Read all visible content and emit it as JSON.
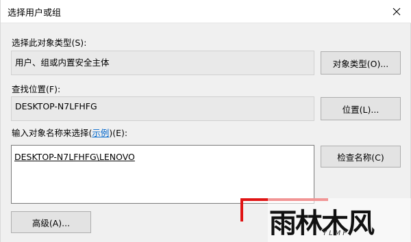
{
  "window": {
    "title": "选择用户或组",
    "close_symbol": "✕"
  },
  "object_type": {
    "label": "选择此对象类型(S):",
    "value": "用户、组或内置安全主体",
    "button": "对象类型(O)..."
  },
  "location": {
    "label": "查找位置(F):",
    "value": "DESKTOP-N7LFHFG",
    "button": "位置(L)..."
  },
  "names": {
    "label_prefix": "输入对象名称来选择(",
    "label_link": "示例",
    "label_suffix": ")(E):",
    "value": "DESKTOP-N7LFHFG\\LENOVO",
    "button": "检查名称(C)"
  },
  "advanced": {
    "button": "高级(A)..."
  },
  "watermark": {
    "text": "雨林木风",
    "sub": "YLMF"
  },
  "colors": {
    "accent_link": "#0066cc",
    "red_mark": "#e01414"
  }
}
